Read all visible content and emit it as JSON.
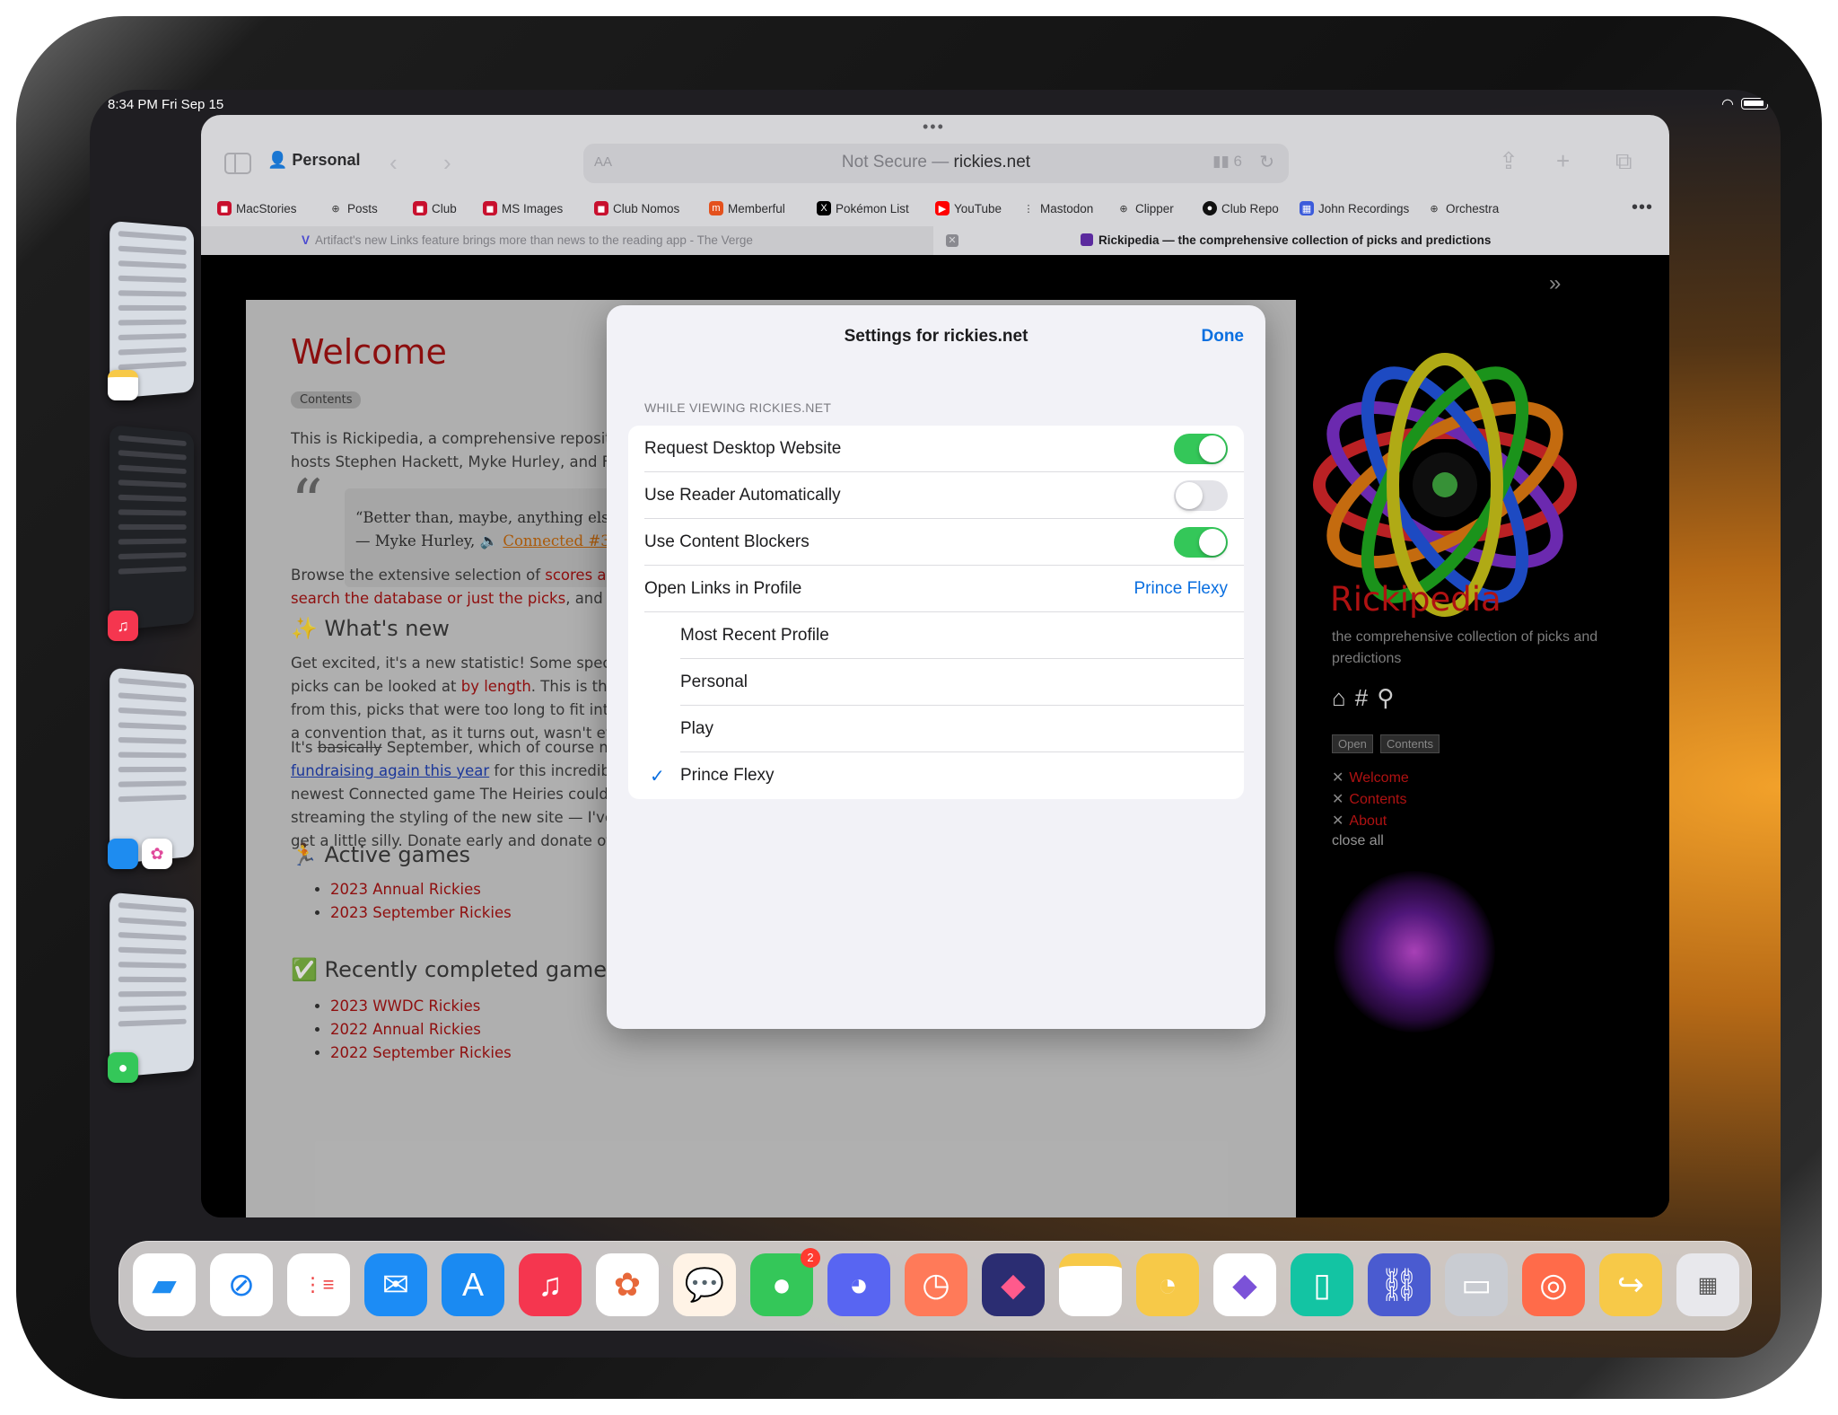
{
  "status": {
    "time": "8:34 PM   Fri Sep 15"
  },
  "safari": {
    "profile": "Personal",
    "url_prefix": "Not Secure —",
    "url_domain": "rickies.net",
    "url_aa": "AA",
    "ext_count": "6",
    "favorites": [
      "MacStories",
      "Posts",
      "Club",
      "MS Images",
      "Club Nomos",
      "Memberful",
      "Pokémon List",
      "YouTube",
      "Mastodon",
      "Clipper",
      "Club Repo",
      "John Recordings",
      "Orchestra"
    ],
    "tab_inactive": "Artifact's new Links feature brings more than news to the reading app - The Verge",
    "tab_active": "Rickipedia — the comprehensive collection of picks and predictions"
  },
  "page": {
    "title": "Welcome",
    "contents_chip": "Contents",
    "intro_1": "This is Rickipedia, a comprehensive reposito",
    "intro_2": "hosts Stephen Hackett, Myke Hurley, and Fe",
    "quote_1": "“Better than, maybe, anything else I",
    "quote_2": "— Myke Hurley, ",
    "quote_link": "Connected #34",
    "browse_1a": "Browse the extensive selection of ",
    "browse_1b": "scores and",
    "browse_2a": "search the database or just the picks",
    "browse_2b": ", and m",
    "whats_new": "✨ What's new",
    "new_1": "Get excited, it's a new statistic! Some specul",
    "new_2a": "picks can be looked at ",
    "new_2b": "by length",
    "new_2c": ". This is the",
    "new_3": "from this, picks that were too long to fit into",
    "new_4": "a convention that, as it turns out, wasn't even",
    "sep_1a": "It's ",
    "sep_1b": "basically",
    "sep_1c": " September, which of course me",
    "sep_2a": "fundraising again this year",
    "sep_2b": " for this incredible",
    "sep_3": "newest Connected game The Heiries could g",
    "sep_4": "streaming the styling of the new site — I've g",
    "sep_5": "get a little silly. Donate early and donate ofte",
    "active_games": "🏃 Active games",
    "active": [
      "2023 Annual Rickies",
      "2023 September Rickies"
    ],
    "completed_games": "✅ Recently completed games",
    "completed": [
      "2023 WWDC Rickies",
      "2022 Annual Rickies",
      "2022 September Rickies"
    ]
  },
  "sidebar": {
    "title": "Rickipedia",
    "subtitle": "the comprehensive collection of picks and predictions",
    "open_btn": "Open",
    "contents_btn": "Contents",
    "links": [
      "Welcome",
      "Contents",
      "About"
    ],
    "close_all": "close all"
  },
  "settings": {
    "title": "Settings for rickies.net",
    "done": "Done",
    "section": "WHILE VIEWING RICKIES.NET",
    "rows": [
      {
        "label": "Request Desktop Website",
        "toggle": true
      },
      {
        "label": "Use Reader Automatically",
        "toggle": false
      },
      {
        "label": "Use Content Blockers",
        "toggle": true
      },
      {
        "label": "Open Links in Profile",
        "value": "Prince Flexy"
      }
    ],
    "profiles": [
      "Most Recent Profile",
      "Personal",
      "Play",
      "Prince Flexy"
    ],
    "selected_profile": "Prince Flexy"
  },
  "dock": {
    "apps": [
      "Files",
      "Safari",
      "Reminders",
      "Mail",
      "App Store",
      "Music",
      "Photos",
      "Mastodon",
      "Messages",
      "Discord",
      "Timery",
      "Shortcuts",
      "Notes",
      "Clock",
      "Obsidian",
      "Phone Mirror",
      "Link",
      "Display",
      "Podcasts",
      "Pushcut",
      "App Library"
    ],
    "messages_badge": "2"
  }
}
